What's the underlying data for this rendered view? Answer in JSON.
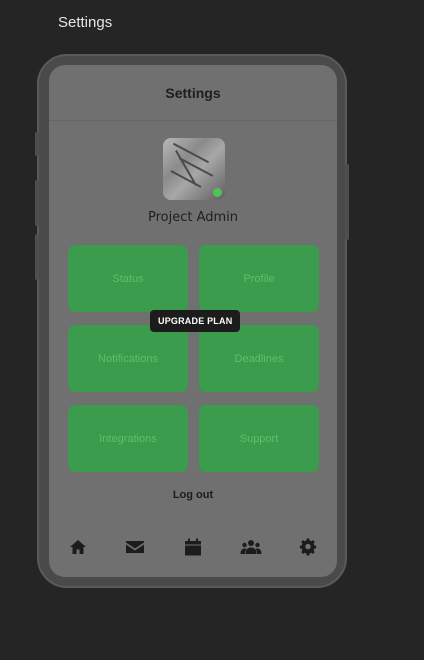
{
  "page": {
    "heading": "Settings"
  },
  "header": {
    "title": "Settings"
  },
  "profile": {
    "name": "Project Admin",
    "status_color": "#4fc25a"
  },
  "tiles": [
    {
      "label": "Status"
    },
    {
      "label": "Profile"
    },
    {
      "label": "Notifications"
    },
    {
      "label": "Deadlines"
    },
    {
      "label": "Integrations"
    },
    {
      "label": "Support"
    }
  ],
  "upgrade": {
    "label": "UPGRADE PLAN"
  },
  "logout": {
    "label": "Log out"
  },
  "nav": {
    "items": [
      {
        "icon": "home-icon"
      },
      {
        "icon": "mail-icon"
      },
      {
        "icon": "calendar-icon"
      },
      {
        "icon": "users-icon"
      },
      {
        "icon": "gear-icon"
      }
    ]
  },
  "colors": {
    "tile_bg": "#3a9c4c",
    "tile_text": "#5ec06c",
    "screen_bg": "#707070",
    "background": "#252525"
  }
}
